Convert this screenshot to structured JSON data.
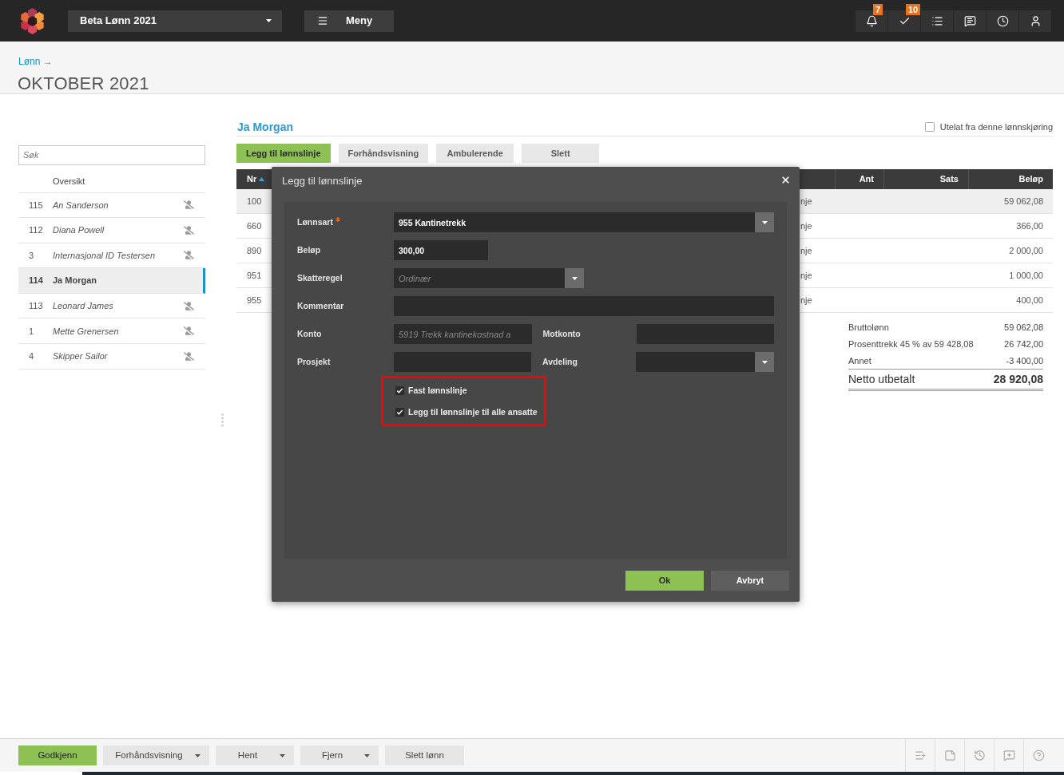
{
  "top_bar": {
    "company": "Beta Lønn 2021",
    "menu_button": "Meny",
    "badges": [
      "7",
      "10"
    ]
  },
  "page_header": {
    "breadcrumb": "Lønn →",
    "title": "OKTOBER 2021"
  },
  "sidebar": {
    "search": {
      "placeholder": "Søk"
    },
    "overview": "Oversikt",
    "employees": [
      {
        "number": "115",
        "name": "An Sanderson",
        "selected": false,
        "excluded": true
      },
      {
        "number": "112",
        "name": "Diana Powell",
        "selected": false,
        "excluded": true
      },
      {
        "number": "3",
        "name": "Internasjonal ID Testersen",
        "selected": false,
        "excluded": true
      },
      {
        "number": "114",
        "name": "Ja Morgan",
        "selected": true,
        "excluded": false
      },
      {
        "number": "113",
        "name": "Leonard James",
        "selected": false,
        "excluded": true
      },
      {
        "number": "1",
        "name": "Mette Grenersen",
        "selected": false,
        "excluded": true
      },
      {
        "number": "4",
        "name": "Skipper Sailor",
        "selected": false,
        "excluded": true
      }
    ]
  },
  "employee": {
    "name": "Ja Morgan",
    "exclude_option": {
      "label": "Utelat fra denne lønnskjøring",
      "checked": false
    },
    "actions": [
      {
        "label": "Legg til lønnslinje",
        "primary": true
      },
      {
        "label": "Forhåndsvisning",
        "primary": false
      },
      {
        "label": "Ambulerende",
        "primary": false
      },
      {
        "label": "Slett",
        "primary": false
      }
    ]
  },
  "table": {
    "columns": [
      {
        "label": "Nr",
        "sorted": true
      },
      {
        "label": "Ant",
        "sorted": false
      },
      {
        "label": "Sats",
        "sorted": false
      },
      {
        "label": "Beløp",
        "sorted": false
      }
    ],
    "rows": [
      {
        "nr": "100",
        "column_2": "nje",
        "amount": "59 062,08",
        "selected": true
      },
      {
        "nr": "660",
        "column_2": "nje",
        "amount": "366,00",
        "selected": false
      },
      {
        "nr": "890",
        "column_2": "nje",
        "amount": "2 000,00",
        "selected": false
      },
      {
        "nr": "951",
        "column_2": "nje",
        "amount": "1 000,00",
        "selected": false
      },
      {
        "nr": "955",
        "column_2": "nje",
        "amount": "400,00",
        "selected": false
      }
    ]
  },
  "summary": {
    "lines": [
      {
        "label": "Bruttolønn",
        "value": "59 062,08"
      },
      {
        "label": "Prosenttrekk 45 % av 59 428,08",
        "value": "26 742,00"
      },
      {
        "label": "Annet",
        "value": "-3 400,00"
      }
    ],
    "total": {
      "label": "Netto utbetalt",
      "value": "28 920,08"
    }
  },
  "dialog": {
    "title": "Legg til lønnslinje",
    "rows": [
      [
        {
          "label": "Lønnsart",
          "required": true,
          "kind": "select",
          "value": "955 Kantinetrekk"
        }
      ],
      [
        {
          "label": "Beløp",
          "required": false,
          "kind": "input",
          "value": "300,00"
        }
      ],
      [
        {
          "label": "Skatteregel",
          "required": false,
          "kind": "select",
          "placeholder": "Ordinær"
        }
      ],
      [
        {
          "label": "Kommentar",
          "required": false,
          "kind": "input"
        }
      ],
      [
        {
          "label": "Konto",
          "required": false,
          "kind": "input",
          "placeholder": "5919 Trekk kantinekostnad a"
        },
        {
          "label": "Motkonto",
          "required": false,
          "kind": "input"
        }
      ],
      [
        {
          "label": "Prosjekt",
          "required": false,
          "kind": "input"
        },
        {
          "label": "Avdeling",
          "required": false,
          "kind": "select"
        }
      ]
    ],
    "options_highlighted": true,
    "options": [
      {
        "label": "Fast lønnslinje",
        "checked": true
      },
      {
        "label": "Legg til lønnslinje til alle ansatte",
        "checked": true
      }
    ],
    "buttons": [
      {
        "label": "Ok",
        "primary": true
      },
      {
        "label": "Avbryt",
        "primary": false
      }
    ]
  },
  "bottom_bar": {
    "buttons": [
      {
        "label": "Godkjenn",
        "primary": true,
        "dropdown": false
      },
      {
        "label": "Forhåndsvisning",
        "primary": false,
        "dropdown": true
      },
      {
        "label": "Hent",
        "primary": false,
        "dropdown": true
      },
      {
        "label": "Fjern",
        "primary": false,
        "dropdown": true
      },
      {
        "label": "Slett lønn",
        "primary": false,
        "dropdown": false
      }
    ]
  }
}
